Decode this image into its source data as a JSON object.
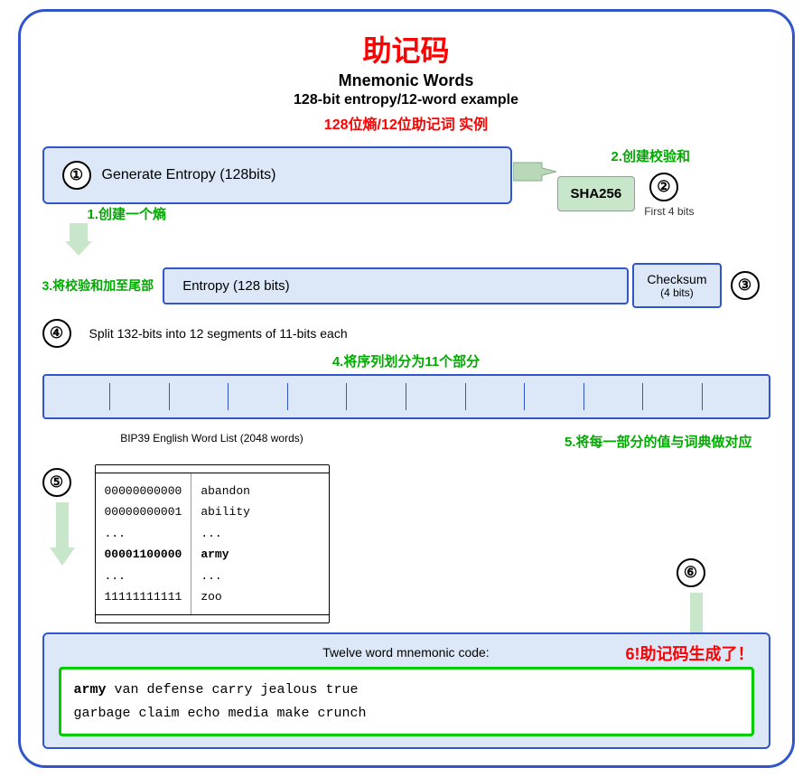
{
  "title": {
    "chinese": "助记码",
    "english_line1": "Mnemonic Words",
    "english_line2": "128-bit entropy/12-word example",
    "chinese_sub": "128位熵/12位助记词 实例"
  },
  "annotations": {
    "step1": "1.创建一个熵",
    "step2": "2.创建校验和",
    "step3": "3.将校验和加至尾部",
    "step4": "4.将序列划分为11个部分",
    "step5": "5.将每一部分的值与词典做对应",
    "step6": "6!助记码生成了！"
  },
  "steps": {
    "s1_label": "Generate Entropy (128bits)",
    "s1_num": "①",
    "sha_label": "SHA256",
    "s2_num": "②",
    "first4bits": "First 4 bits",
    "s3_annotation": "3.将校验和加至尾部",
    "s3_label": "Entropy (128 bits)",
    "checksum_label": "Checksum",
    "checksum_bits": "(4 bits)",
    "s3_num": "③",
    "s4_num": "④",
    "s4_text": "Split 132-bits into 12 segments of 11-bits each",
    "s5_num": "⑤",
    "s6_num": "⑥",
    "wordlist_title": "BIP39 English Word List (2048 words)",
    "wl_binary": [
      "00000000000",
      "00000000001",
      "...",
      "00001100000",
      "...",
      "11111111111"
    ],
    "wl_words": [
      "abandon",
      "ability",
      "...",
      "army",
      "...",
      "zoo"
    ],
    "output_label": "Twelve word mnemonic code:",
    "mnemonic_bold": "army",
    "mnemonic_rest": " van defense carry jealous true\ngarbage claim echo media make crunch"
  }
}
